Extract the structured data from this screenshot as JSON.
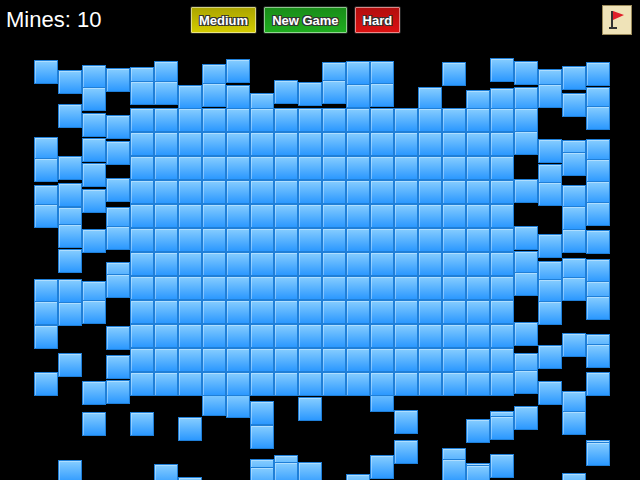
{
  "mines_label": "Mines: 10",
  "buttons": [
    {
      "label": "Medium",
      "color": "#d4cc00"
    },
    {
      "label": "New Game",
      "color": "#1fae1f"
    },
    {
      "label": "Hard",
      "color": "#dd1111"
    }
  ],
  "board": {
    "covered": [
      [
        true,
        true,
        true,
        true,
        true,
        true,
        true,
        true,
        true,
        true,
        true,
        true,
        true,
        true,
        true,
        true
      ],
      [
        true,
        true,
        true,
        true,
        true,
        true,
        true,
        true,
        true,
        true,
        true,
        true,
        true,
        true,
        true,
        true
      ],
      [
        true,
        true,
        true,
        true,
        true,
        true,
        true,
        true,
        true,
        true,
        true,
        true,
        true,
        true,
        true,
        true
      ],
      [
        true,
        true,
        true,
        true,
        true,
        true,
        true,
        true,
        true,
        true,
        true,
        true,
        true,
        true,
        true,
        true
      ],
      [
        true,
        true,
        true,
        true,
        true,
        true,
        true,
        true,
        true,
        true,
        true,
        true,
        true,
        true,
        true,
        true
      ],
      [
        true,
        true,
        true,
        true,
        true,
        true,
        true,
        true,
        true,
        true,
        true,
        true,
        true,
        true,
        true,
        true
      ],
      [
        true,
        true,
        true,
        true,
        true,
        true,
        true,
        true,
        true,
        true,
        true,
        true,
        true,
        true,
        true,
        true
      ],
      [
        true,
        true,
        true,
        true,
        true,
        true,
        true,
        true,
        true,
        true,
        true,
        true,
        true,
        true,
        true,
        true
      ],
      [
        true,
        true,
        true,
        true,
        true,
        true,
        true,
        true,
        true,
        true,
        true,
        true,
        true,
        true,
        true,
        true
      ],
      [
        true,
        true,
        true,
        true,
        true,
        true,
        true,
        true,
        true,
        true,
        true,
        true,
        true,
        true,
        true,
        true
      ],
      [
        true,
        true,
        true,
        true,
        true,
        true,
        true,
        true,
        true,
        true,
        true,
        true,
        true,
        true,
        true,
        true
      ],
      [
        true,
        true,
        true,
        true,
        true,
        true,
        true,
        true,
        true,
        true,
        true,
        true,
        true,
        true,
        true,
        true
      ]
    ]
  }
}
